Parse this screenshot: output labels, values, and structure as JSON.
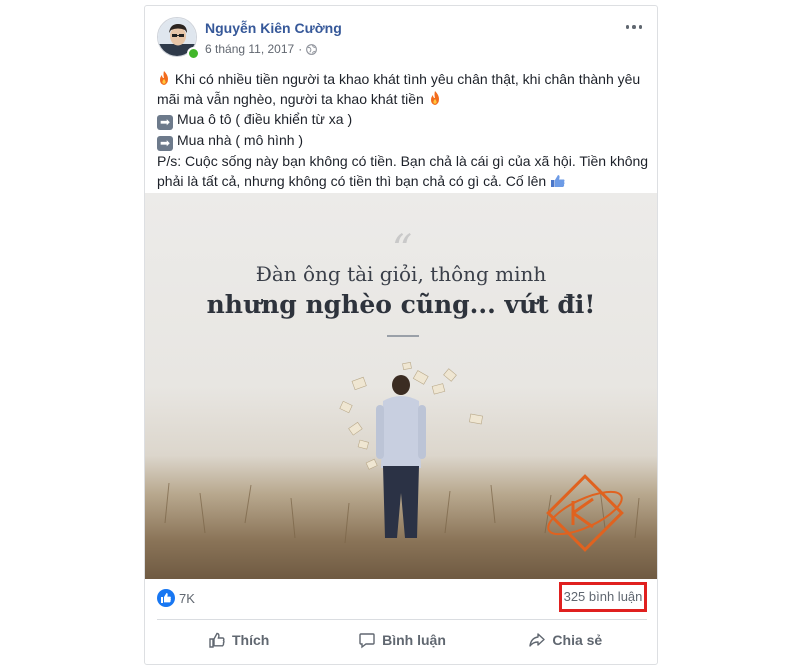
{
  "post": {
    "author": "Nguyễn Kiên Cường",
    "date": "6 tháng 11, 2017",
    "privacy_icon": "globe-icon",
    "lines": {
      "line1": "Khi có nhiều tiền người ta khao khát tình yêu chân thật, khi chân thành yêu mãi mà vẫn nghèo, người ta khao khát tiền",
      "line2": "Mua ô tô ( điều khiển từ xa )",
      "line3": "Mua nhà ( mô hình )",
      "line4": "P/s: Cuộc sống này bạn không có tiền. Bạn chả là cái gì của xã hội. Tiền không phải là tất cả, nhưng không có tiền thì bạn chả có gì cả. Cố lên"
    },
    "image": {
      "quote": "“",
      "headline1": "Đàn ông tài giỏi, thông minh",
      "headline2": "nhưng nghèo cũng... vứt đi!"
    }
  },
  "stats": {
    "likes": "7K",
    "comments": "325 bình luận",
    "highlight_color": "#e0201f"
  },
  "actions": {
    "like": "Thích",
    "comment": "Bình luận",
    "share": "Chia sẻ"
  },
  "colors": {
    "link": "#365899",
    "facebook_blue": "#1877f2",
    "online": "#42b72a"
  }
}
